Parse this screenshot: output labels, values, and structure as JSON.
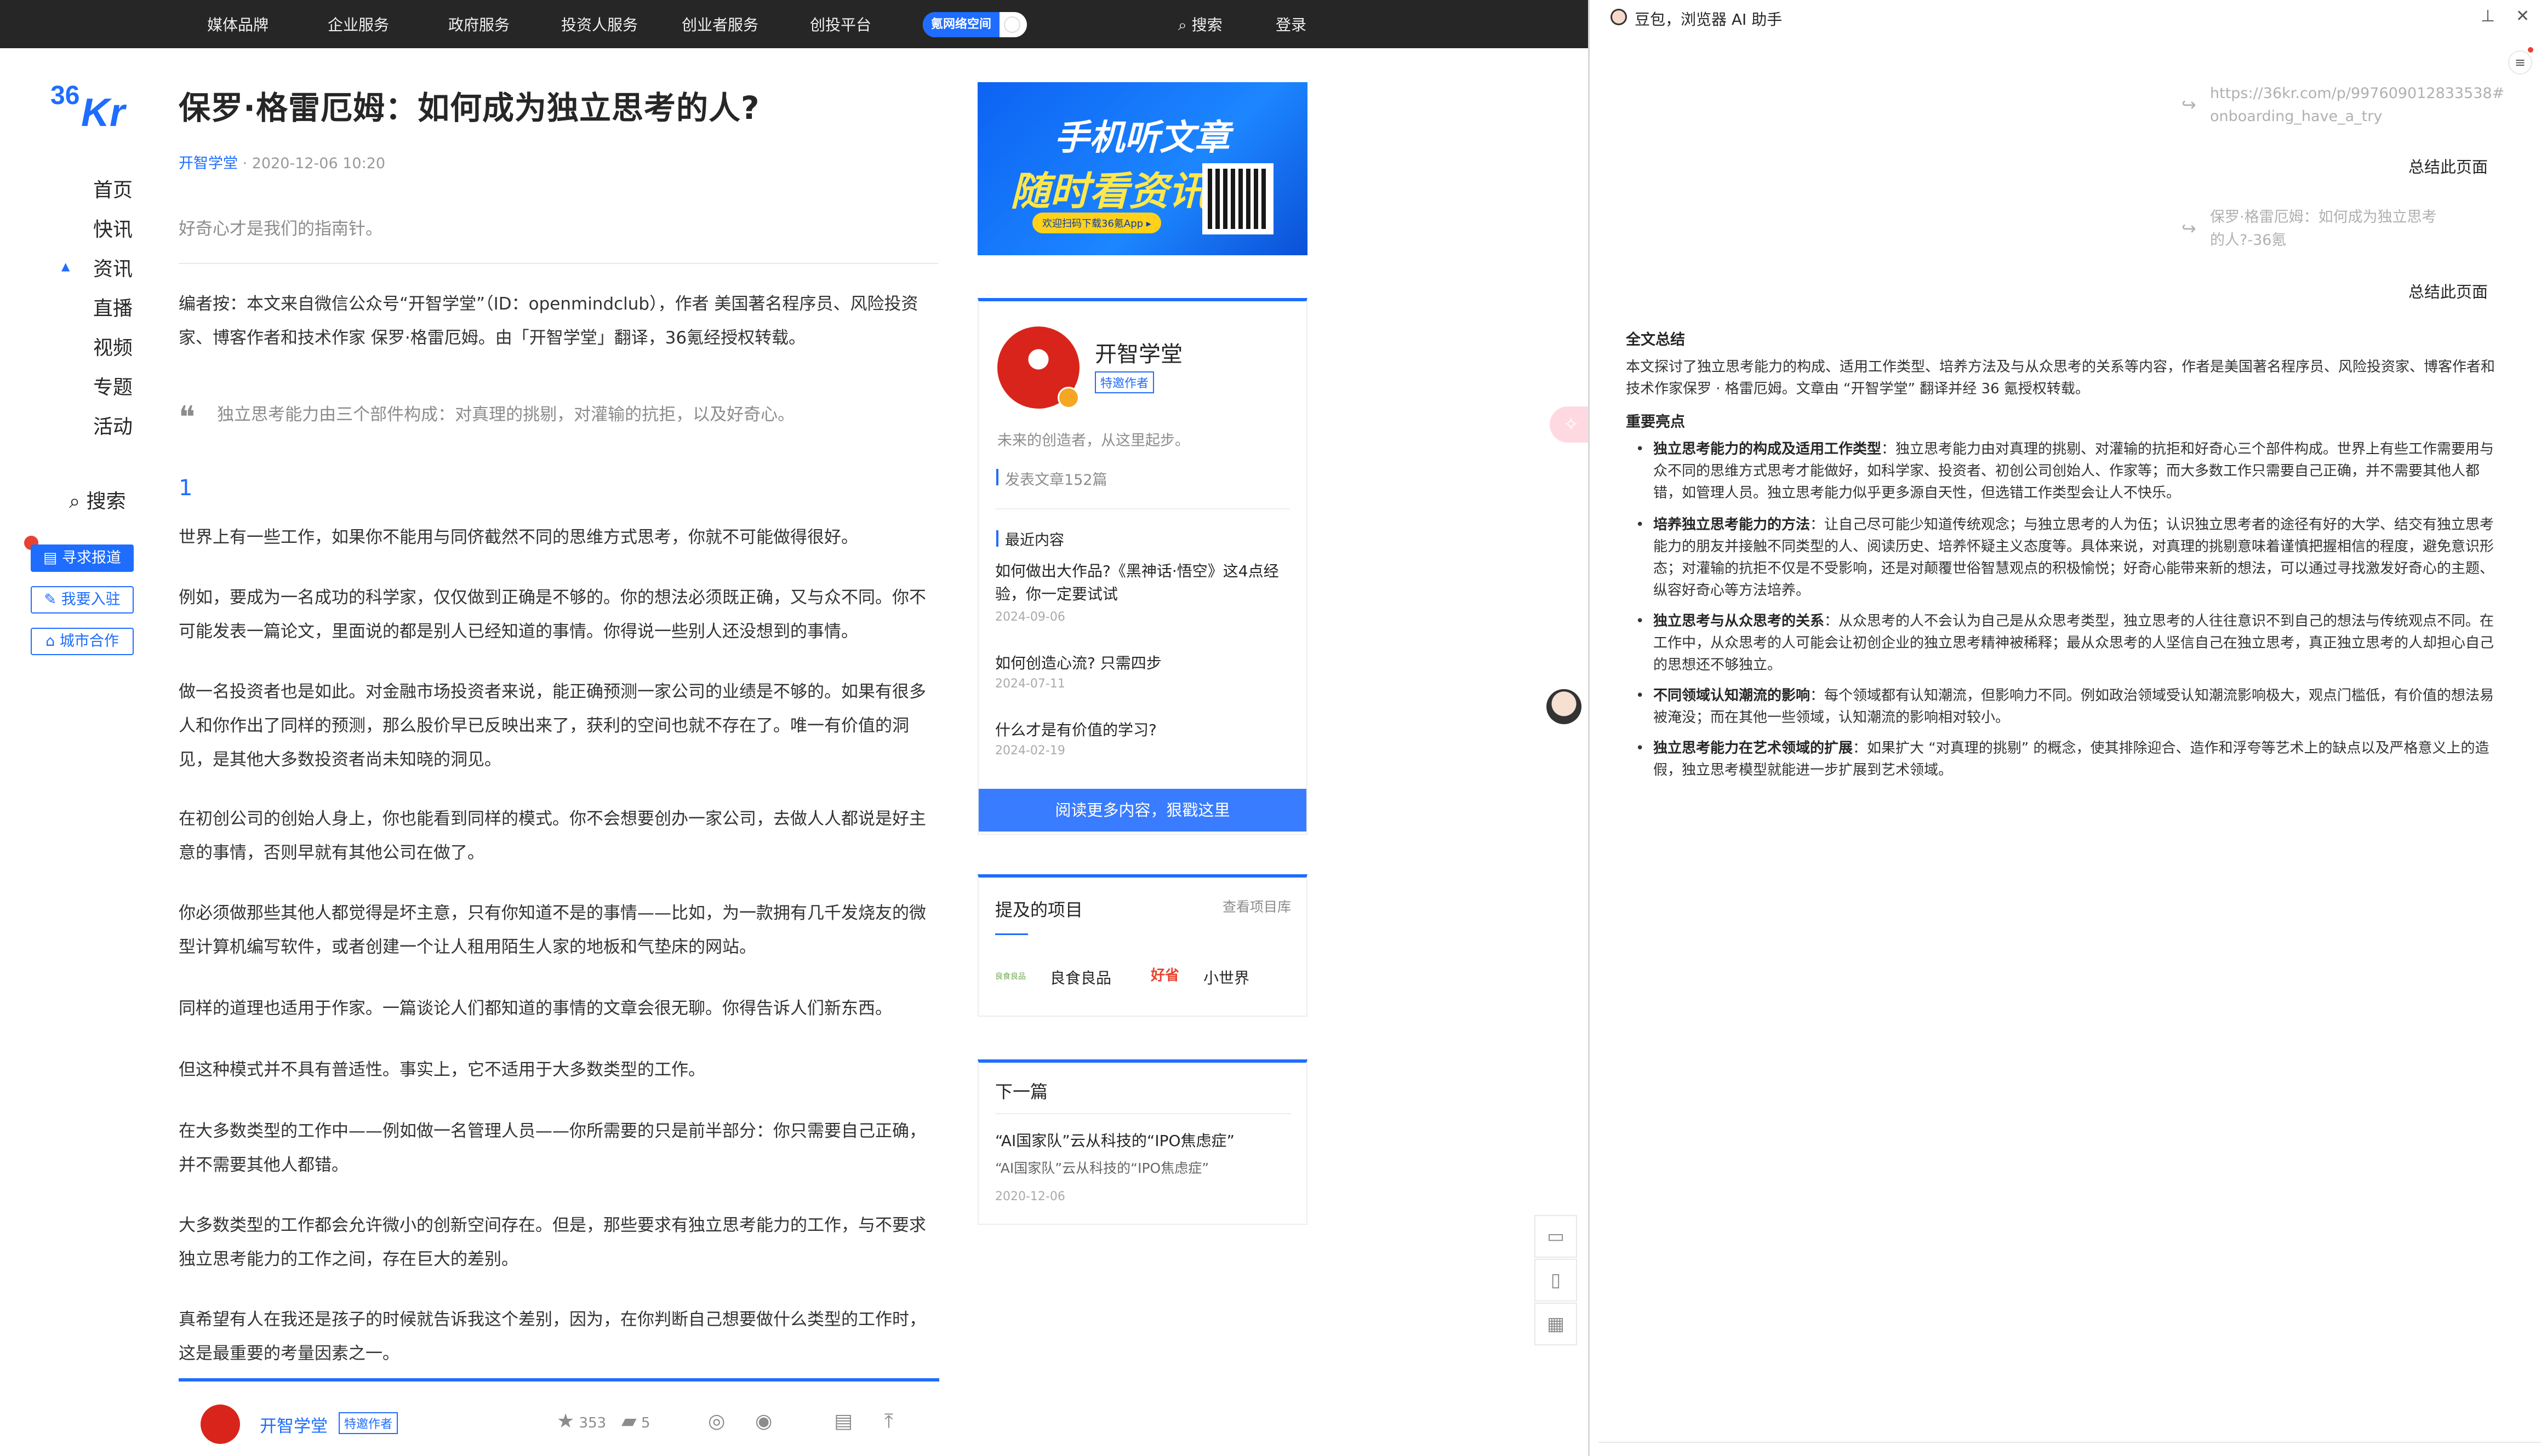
{
  "topnav": {
    "items": [
      "媒体品牌",
      "企业服务",
      "政府服务",
      "投资人服务",
      "创业者服务",
      "创投平台"
    ],
    "promo": "氪网络空间",
    "search": "搜索",
    "login": "登录"
  },
  "logo": "36Kr",
  "leftnav": {
    "items": [
      "首页",
      "快讯",
      "资讯",
      "直播",
      "视频",
      "专题",
      "活动"
    ],
    "search": "搜索",
    "buttons": [
      "寻求报道",
      "我要入驻",
      "城市合作"
    ]
  },
  "article": {
    "title": "保罗·格雷厄姆：如何成为独立思考的人?",
    "author": "开智学堂",
    "date": "2020-12-06 10:20",
    "summary": "好奇心才是我们的指南针。",
    "editor_note": "编者按：本文来自微信公众号“开智学堂”（ID：openmindclub），作者 美国著名程序员、风险投资家、博客作者和技术作家 保罗·格雷厄姆。由「开智学堂」翻译，36氪经授权转载。",
    "quote": "独立思考能力由三个部件构成：对真理的挑剔，对灌输的抗拒，以及好奇心。",
    "section": "1",
    "paragraphs": [
      "世界上有一些工作，如果你不能用与同侪截然不同的思维方式思考，你就不可能做得很好。",
      "例如，要成为一名成功的科学家，仅仅做到正确是不够的。你的想法必须既正确，又与众不同。你不可能发表一篇论文，里面说的都是别人已经知道的事情。你得说一些别人还没想到的事情。",
      "做一名投资者也是如此。对金融市场投资者来说，能正确预测一家公司的业绩是不够的。如果有很多人和你作出了同样的预测，那么股价早已反映出来了，获利的空间也就不存在了。唯一有价值的洞见，是其他大多数投资者尚未知晓的洞见。",
      "在初创公司的创始人身上，你也能看到同样的模式。你不会想要创办一家公司，去做人人都说是好主意的事情，否则早就有其他公司在做了。",
      "你必须做那些其他人都觉得是坏主意，只有你知道不是的事情——比如，为一款拥有几千发烧友的微型计算机编写软件，或者创建一个让人租用陌生人家的地板和气垫床的网站。",
      "同样的道理也适用于作家。一篇谈论人们都知道的事情的文章会很无聊。你得告诉人们新东西。",
      "但这种模式并不具有普适性。事实上，它不适用于大多数类型的工作。",
      "在大多数类型的工作中——例如做一名管理人员——你所需要的只是前半部分：你只需要自己正确，并不需要其他人都错。",
      "大多数类型的工作都会允许微小的创新空间存在。但是，那些要求有独立思考能力的工作，与不要求独立思考能力的工作之间，存在巨大的差别。",
      "真希望有人在我还是孩子的时候就告诉我这个差别，因为，在你判断自己想要做什么类型的工作时，这是最重要的考量因素之一。"
    ]
  },
  "bottombar": {
    "author": "开智学堂",
    "tag": "特邀作者",
    "likes": "353",
    "comments": "5"
  },
  "ad": {
    "line1": "手机听文章",
    "line2": "随时看资讯",
    "line3": "欢迎扫码下载36氪App ▸"
  },
  "authorcard": {
    "name": "开智学堂",
    "tag": "特邀作者",
    "bio": "未来的创造者，从这里起步。",
    "articles": "发表文章152篇",
    "recent_title": "最近内容",
    "recent": [
      {
        "title": "如何做出大作品?《黑神话·悟空》这4点经验，你一定要试试",
        "date": "2024-09-06"
      },
      {
        "title": "如何创造心流? 只需四步",
        "date": "2024-07-11"
      },
      {
        "title": "什么才是有价值的学习?",
        "date": "2024-02-19"
      }
    ],
    "readmore": "阅读更多内容，狠戳这里"
  },
  "projects": {
    "title": "提及的项目",
    "link": "查看项目库",
    "items": [
      {
        "logo": "良食良品",
        "name": "良食良品"
      },
      {
        "logo": "好省",
        "name": "小世界"
      }
    ]
  },
  "next": {
    "title": "下一篇",
    "headline": "“AI国家队”云从科技的“IPO焦虑症”",
    "sub": "“AI国家队”云从科技的“IPO焦虑症”",
    "date": "2020-12-06"
  },
  "panel": {
    "title": "豆包，浏览器 AI 助手",
    "msg1_link": "https://36kr.com/p/997609012833538#onboarding_have_a_try",
    "msg1_text": "总结此页面",
    "msg2_link": "保罗·格雷厄姆：如何成为独立思考的人?-36氪",
    "msg2_text": "总结此页面",
    "summary_heading": "全文总结",
    "summary": "本文探讨了独立思考能力的构成、适用工作类型、培养方法及与从众思考的关系等内容，作者是美国著名程序员、风险投资家、博客作者和技术作家保罗 · 格雷厄姆。文章由 “开智学堂” 翻译并经 36 氪授权转载。",
    "highlights_heading": "重要亮点",
    "highlights": [
      {
        "head": "独立思考能力的构成及适用工作类型",
        "body": "：独立思考能力由对真理的挑剔、对灌输的抗拒和好奇心三个部件构成。世界上有些工作需要用与众不同的思维方式思考才能做好，如科学家、投资者、初创公司创始人、作家等；而大多数工作只需要自己正确，并不需要其他人都错，如管理人员。独立思考能力似乎更多源自天性，但选错工作类型会让人不快乐。"
      },
      {
        "head": "培养独立思考能力的方法",
        "body": "：让自己尽可能少知道传统观念；与独立思考的人为伍；认识独立思考者的途径有好的大学、结交有独立思考能力的朋友并接触不同类型的人、阅读历史、培养怀疑主义态度等。具体来说，对真理的挑剔意味着谨慎把握相信的程度，避免意识形态；对灌输的抗拒不仅是不受影响，还是对颠覆世俗智慧观点的积极愉悦；好奇心能带来新的想法，可以通过寻找激发好奇心的主题、纵容好奇心等方法培养。"
      },
      {
        "head": "独立思考与从众思考的关系",
        "body": "：从众思考的人不会认为自己是从众思考类型，独立思考的人往往意识不到自己的想法与传统观点不同。在工作中，从众思考的人可能会让初创企业的独立思考精神被稀释；最从众思考的人坚信自己在独立思考，真正独立思考的人却担心自己的思想还不够独立。"
      },
      {
        "head": "不同领域认知潮流的影响",
        "body": "：每个领域都有认知潮流，但影响力不同。例如政治领域受认知潮流影响极大，观点门槛低，有价值的想法易被淹没；而在其他一些领域，认知潮流的影响相对较小。"
      },
      {
        "head": "独立思考能力在艺术领域的扩展",
        "body": "：如果扩大 “对真理的挑剔” 的概念，使其排除迎合、造作和浮夸等艺术上的缺点以及严格意义上的造假，独立思考模型就能进一步扩展到艺术领域。"
      }
    ]
  },
  "colors": {
    "accent": "#1e6dff",
    "nav_bg": "#262626",
    "brand_red": "#d9241b"
  }
}
